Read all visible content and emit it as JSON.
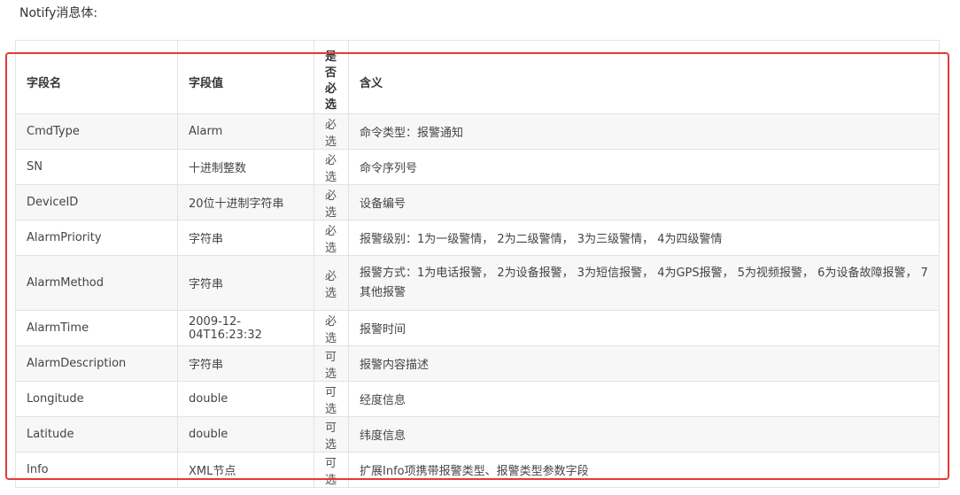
{
  "heading": "Notify消息体:",
  "table": {
    "headers": [
      "字段名",
      "字段值",
      "是否必选",
      "含义"
    ],
    "rows": [
      {
        "name": "CmdType",
        "value": "Alarm",
        "required": "必选",
        "meaning": "命令类型：报警通知"
      },
      {
        "name": "SN",
        "value": "十进制整数",
        "required": "必选",
        "meaning": "命令序列号"
      },
      {
        "name": "DeviceID",
        "value": "20位十进制字符串",
        "required": "必选",
        "meaning": "设备编号"
      },
      {
        "name": "AlarmPriority",
        "value": "字符串",
        "required": "必选",
        "meaning": "报警级别：1为一级警情， 2为二级警情， 3为三级警情， 4为四级警情"
      },
      {
        "name": "AlarmMethod",
        "value": "字符串",
        "required": "必选",
        "meaning": "报警方式：1为电话报警， 2为设备报警， 3为短信报警， 4为GPS报警， 5为视频报警， 6为设备故障报警， 7其他报警"
      },
      {
        "name": "AlarmTime",
        "value": "2009-12-04T16:23:32",
        "required": "必选",
        "meaning": "报警时间"
      },
      {
        "name": "AlarmDescription",
        "value": "字符串",
        "required": "可选",
        "meaning": "报警内容描述"
      },
      {
        "name": "Longitude",
        "value": "double",
        "required": "可选",
        "meaning": "经度信息"
      },
      {
        "name": "Latitude",
        "value": "double",
        "required": "可选",
        "meaning": "纬度信息"
      },
      {
        "name": "Info",
        "value": "XML节点",
        "required": "可选",
        "meaning": "扩展Info项携带报警类型、报警类型参数字段"
      }
    ]
  },
  "highlight_color": "#e53935"
}
